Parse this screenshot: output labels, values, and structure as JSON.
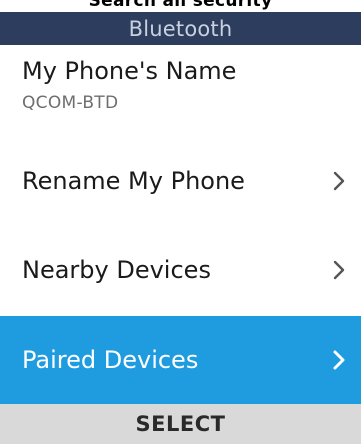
{
  "statusbar": {
    "text": "Search all security"
  },
  "header": {
    "title": "Bluetooth"
  },
  "phone_name": {
    "label": "My Phone's Name",
    "value": "QCOM-BTD"
  },
  "menu": {
    "items": [
      {
        "label": "Rename My Phone",
        "icon": "chevron-right-icon"
      },
      {
        "label": "Nearby Devices",
        "icon": "chevron-right-icon"
      },
      {
        "label": "Paired Devices",
        "icon": "chevron-right-icon",
        "selected": true
      }
    ]
  },
  "softkey": {
    "center_label": "SELECT"
  },
  "colors": {
    "header_bg": "#2c3d5e",
    "header_text": "#c9d1de",
    "selection": "#1f9ce0",
    "softkey_bg": "#d9d9d9"
  }
}
